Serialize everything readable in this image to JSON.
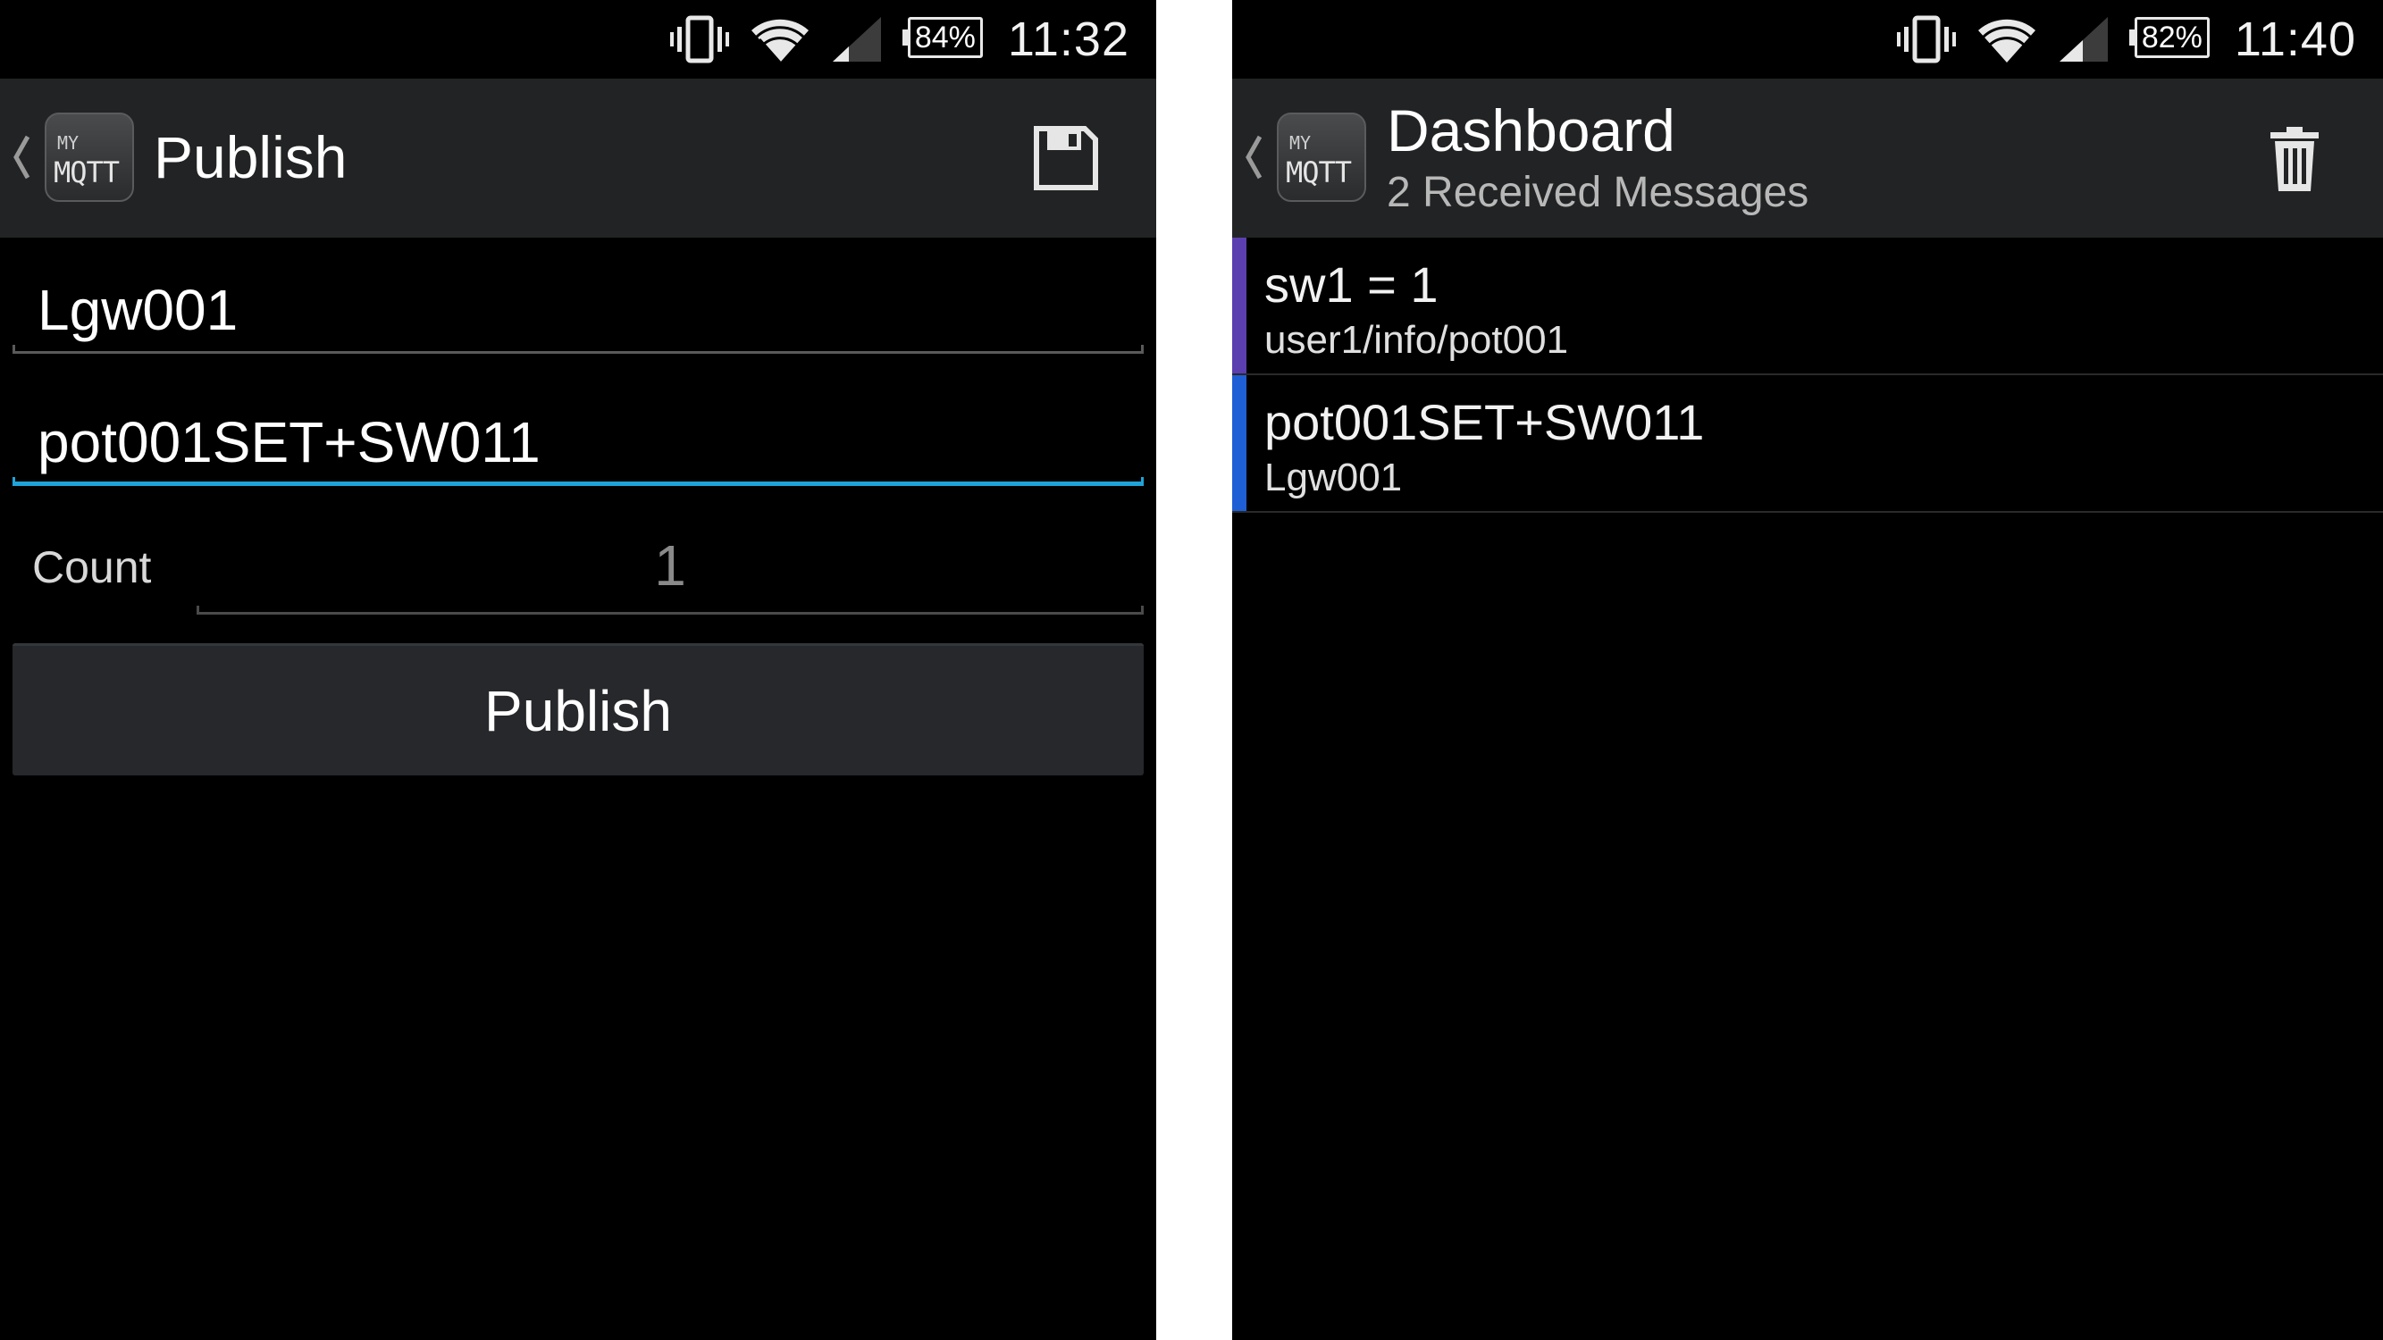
{
  "publish_screen": {
    "status": {
      "battery": "84%",
      "time": "11:32"
    },
    "title": "Publish",
    "app_logo": {
      "line1": "MY",
      "line2": "MQTT"
    },
    "topic_value": "Lgw001",
    "message_value": "pot001SET+SW011",
    "count_label": "Count",
    "count_value": "1",
    "publish_button": "Publish"
  },
  "dashboard_screen": {
    "status": {
      "battery": "82%",
      "time": "11:40"
    },
    "title": "Dashboard",
    "subtitle": "2 Received Messages",
    "app_logo": {
      "line1": "MY",
      "line2": "MQTT"
    },
    "messages": [
      {
        "payload": "sw1 = 1",
        "topic": "user1/info/pot001",
        "color": "#5b3fb0"
      },
      {
        "payload": "pot001SET+SW011",
        "topic": "Lgw001",
        "color": "#1f5fd6"
      }
    ]
  },
  "colors": {
    "accent": "#1fa4d9",
    "actionbar": "#222324",
    "background": "#000000"
  },
  "icons": [
    "vibrate-icon",
    "wifi-icon",
    "signal-icon",
    "battery-icon",
    "back-caret-icon",
    "save-icon",
    "trash-icon"
  ]
}
